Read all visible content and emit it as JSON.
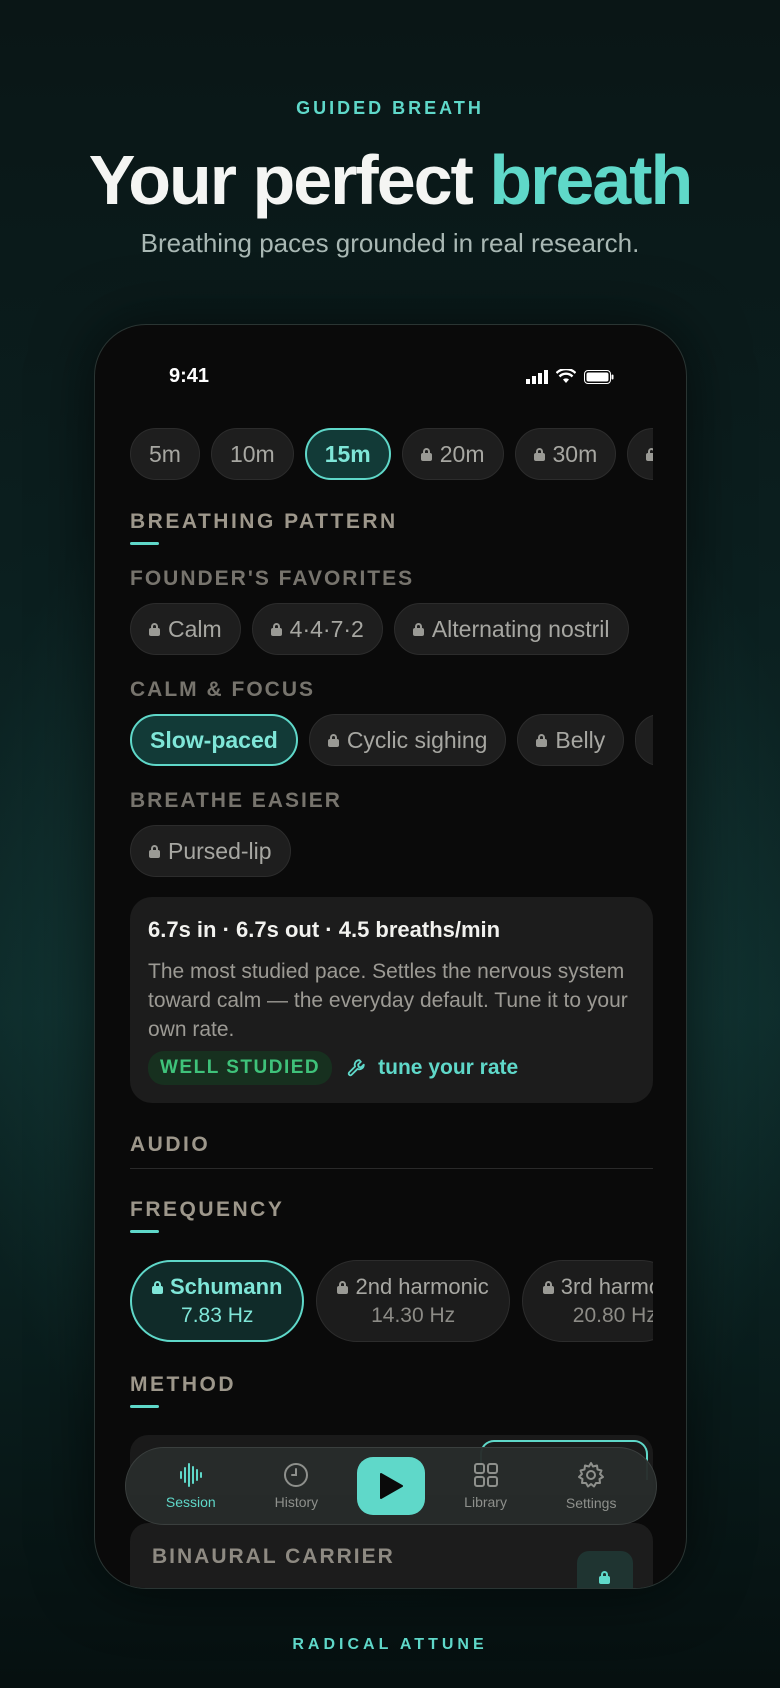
{
  "hero": {
    "eyebrow": "GUIDED BREATH",
    "headline_main": "Your perfect ",
    "headline_accent": "breath",
    "subhead": "Breathing paces grounded in real research."
  },
  "status_bar": {
    "time": "9:41"
  },
  "durations": [
    {
      "label": "5m",
      "locked": false,
      "selected": false
    },
    {
      "label": "10m",
      "locked": false,
      "selected": false
    },
    {
      "label": "15m",
      "locked": false,
      "selected": true
    },
    {
      "label": "20m",
      "locked": true,
      "selected": false
    },
    {
      "label": "30m",
      "locked": true,
      "selected": false
    },
    {
      "label": "",
      "locked": true,
      "selected": false
    }
  ],
  "breathing_pattern": {
    "title": "BREATHING PATTERN",
    "groups": [
      {
        "label": "FOUNDER'S FAVORITES",
        "items": [
          "Calm",
          "4·4·7·2",
          "Alternating nostril"
        ]
      },
      {
        "label": "CALM & FOCUS",
        "items": [
          "Slow-paced",
          "Cyclic sighing",
          "Belly"
        ]
      },
      {
        "label": "BREATHE EASIER",
        "items": [
          "Pursed-lip"
        ]
      }
    ]
  },
  "pattern_info": {
    "title": "6.7s in · 6.7s out · 4.5 breaths/min",
    "body": "The most studied pace. Settles the nervous system toward calm — the everyday default. Tune it to your own rate.",
    "badge": "WELL STUDIED",
    "tune_link": "tune your rate"
  },
  "audio": {
    "title": "AUDIO"
  },
  "frequency": {
    "title": "FREQUENCY",
    "options": [
      {
        "name": "Schumann",
        "value": "7.83 Hz",
        "selected": true
      },
      {
        "name": "2nd harmonic",
        "value": "14.30 Hz",
        "selected": false
      },
      {
        "name": "3rd harmo",
        "value": "20.80 Hz",
        "selected": false
      }
    ]
  },
  "method": {
    "title": "METHOD"
  },
  "carrier": {
    "title": "BINAURAL CARRIER"
  },
  "tabbar": {
    "session": "Session",
    "history": "History",
    "library": "Library",
    "settings": "Settings"
  },
  "footer": "RADICAL ATTUNE",
  "colors": {
    "accent": "#5fd8c9",
    "badge_green": "#3fc27a",
    "background": "#0a0a0a"
  }
}
